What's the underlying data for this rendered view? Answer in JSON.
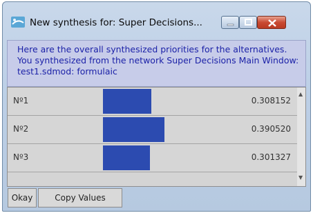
{
  "window": {
    "title": "New synthesis for: Super Decisions...",
    "icon": "super-decisions-app-icon"
  },
  "header": {
    "text": "Here are the overall synthesized priorities for the alternatives.  You synthesized from the network Super Decisions Main Window: test1.sdmod: formulaic"
  },
  "results": {
    "rows": [
      {
        "label": "Nº1",
        "value": "0.308152",
        "priority": 0.308152
      },
      {
        "label": "Nº2",
        "value": "0.390520",
        "priority": 0.39052
      },
      {
        "label": "Nº3",
        "value": "0.301327",
        "priority": 0.301327
      }
    ]
  },
  "buttons": {
    "okay": "Okay",
    "copy_values": "Copy Values"
  },
  "colors": {
    "bar": "#2c4bb0",
    "header_text": "#1c22a8",
    "header_bg": "#c7cce9"
  }
}
